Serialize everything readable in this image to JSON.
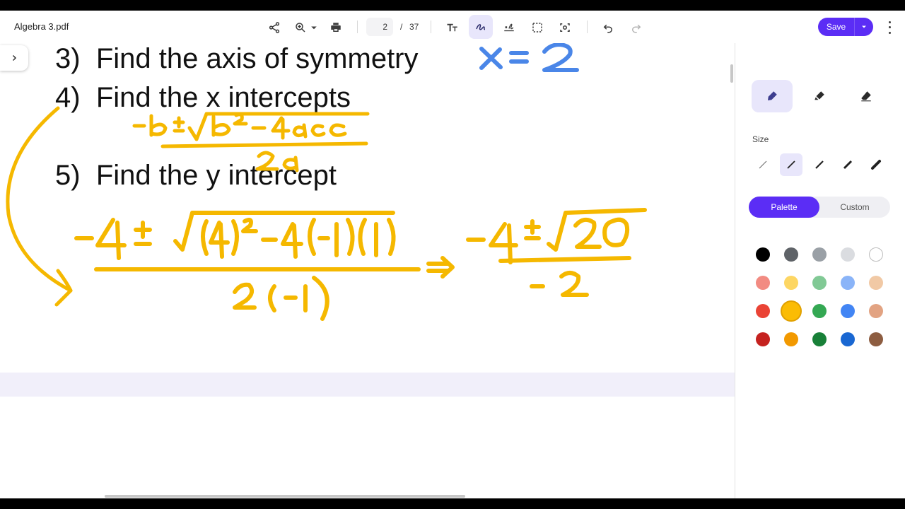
{
  "toolbar": {
    "filename": "Algebra 3.pdf",
    "current_page": "2",
    "page_separator": "/",
    "total_pages": "37",
    "save_label": "Save",
    "icons": [
      "share-icon",
      "zoom-in-icon",
      "chevron-down-icon",
      "print-icon",
      "text-icon",
      "draw-icon",
      "signature-icon",
      "select-icon",
      "screen-search-icon",
      "undo-icon",
      "redo-icon",
      "more-icon"
    ]
  },
  "document": {
    "lines": [
      {
        "number": "3)",
        "text": "Find the axis of symmetry"
      },
      {
        "number": "4)",
        "text": "Find the x intercepts"
      },
      {
        "number": "5)",
        "text": "Find the y intercept"
      }
    ],
    "handwriting": {
      "blue": "x = 2",
      "yellow_formula": "-b ± √(b² - 4ac) / 2a",
      "yellow_work": "-4 ± √((4)² - 4(-1)(1)) / 2(-1) ⇒ -4 ± √20 / -2"
    }
  },
  "panel": {
    "tools": [
      "pen-icon",
      "highlighter-icon",
      "eraser-icon"
    ],
    "size_label": "Size",
    "tabs": {
      "palette": "Palette",
      "custom": "Custom"
    },
    "colors": [
      [
        "#000000",
        "#5f6368",
        "#9aa0a6",
        "#dadce0",
        "#ffffff"
      ],
      [
        "#f28b82",
        "#fdd663",
        "#81c995",
        "#8ab4f8",
        "#f1c9a5"
      ],
      [
        "#ea4335",
        "#fbbc04",
        "#34a853",
        "#4285f4",
        "#e2a382"
      ],
      [
        "#c5221f",
        "#f29900",
        "#188038",
        "#1967d2",
        "#8d5d41"
      ]
    ],
    "selected_color": "#fbbc04"
  },
  "accent": "#5b2df5"
}
